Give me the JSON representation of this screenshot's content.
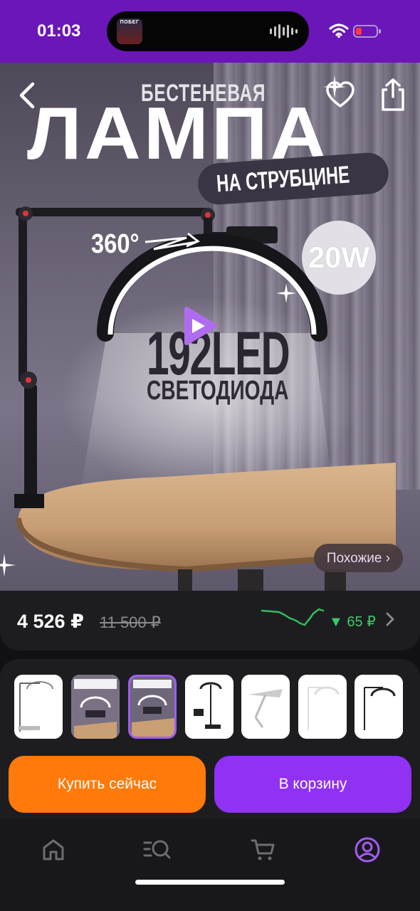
{
  "status_bar": {
    "time": "01:03",
    "island_thumb_text": "ПОБЕГ"
  },
  "product": {
    "image": {
      "subtitle": "БЕСТЕНЕВАЯ",
      "title": "ЛАМПА",
      "tag": "НА СТРУБЦИНЕ",
      "rotation": "360°",
      "power": "20W",
      "led_count": "192LED",
      "led_sub": "СВЕТОДИОДА"
    },
    "similar_label": "Похожие ›"
  },
  "price": {
    "current": "4 526 ₽",
    "old": "11 500 ₽",
    "drop": "▼ 65 ₽"
  },
  "thumbnails": {
    "selected_index": 2,
    "count": 7
  },
  "actions": {
    "buy_now_label": "Купить сейчас",
    "add_to_cart_label": "В корзину"
  },
  "tab_bar": {
    "items": [
      "home-icon",
      "catalog-search-icon",
      "cart-icon",
      "profile-icon"
    ],
    "active_index": 3,
    "active_color": "#a35cf0",
    "inactive_color": "#6c6c72"
  },
  "colors": {
    "status_bar": "#6b16b8",
    "buy_now": "#ff7a0a",
    "add_to_cart": "#9031f3",
    "price_drop": "#3dc86a"
  }
}
